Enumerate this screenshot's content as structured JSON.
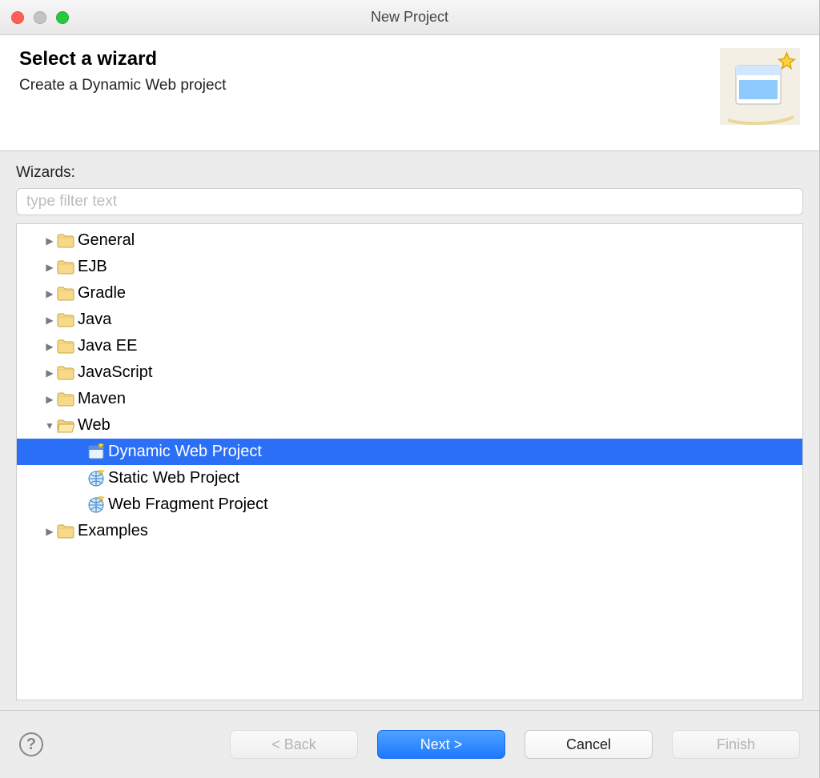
{
  "window": {
    "title": "New Project"
  },
  "header": {
    "heading": "Select a wizard",
    "subheading": "Create a Dynamic Web project"
  },
  "filter": {
    "label": "Wizards:",
    "placeholder": "type filter text",
    "value": ""
  },
  "tree": {
    "folders": [
      {
        "label": "General",
        "expanded": false
      },
      {
        "label": "EJB",
        "expanded": false
      },
      {
        "label": "Gradle",
        "expanded": false
      },
      {
        "label": "Java",
        "expanded": false
      },
      {
        "label": "Java EE",
        "expanded": false
      },
      {
        "label": "JavaScript",
        "expanded": false
      },
      {
        "label": "Maven",
        "expanded": false
      },
      {
        "label": "Web",
        "expanded": true,
        "children": [
          {
            "label": "Dynamic Web Project",
            "icon": "wizard-app-icon",
            "selected": true
          },
          {
            "label": "Static Web Project",
            "icon": "wizard-globe-icon",
            "selected": false
          },
          {
            "label": "Web Fragment Project",
            "icon": "wizard-globe-icon",
            "selected": false
          }
        ]
      },
      {
        "label": "Examples",
        "expanded": false
      }
    ]
  },
  "buttons": {
    "back": {
      "label": "< Back",
      "enabled": false
    },
    "next": {
      "label": "Next >",
      "enabled": true,
      "primary": true
    },
    "cancel": {
      "label": "Cancel",
      "enabled": true
    },
    "finish": {
      "label": "Finish",
      "enabled": false
    }
  }
}
